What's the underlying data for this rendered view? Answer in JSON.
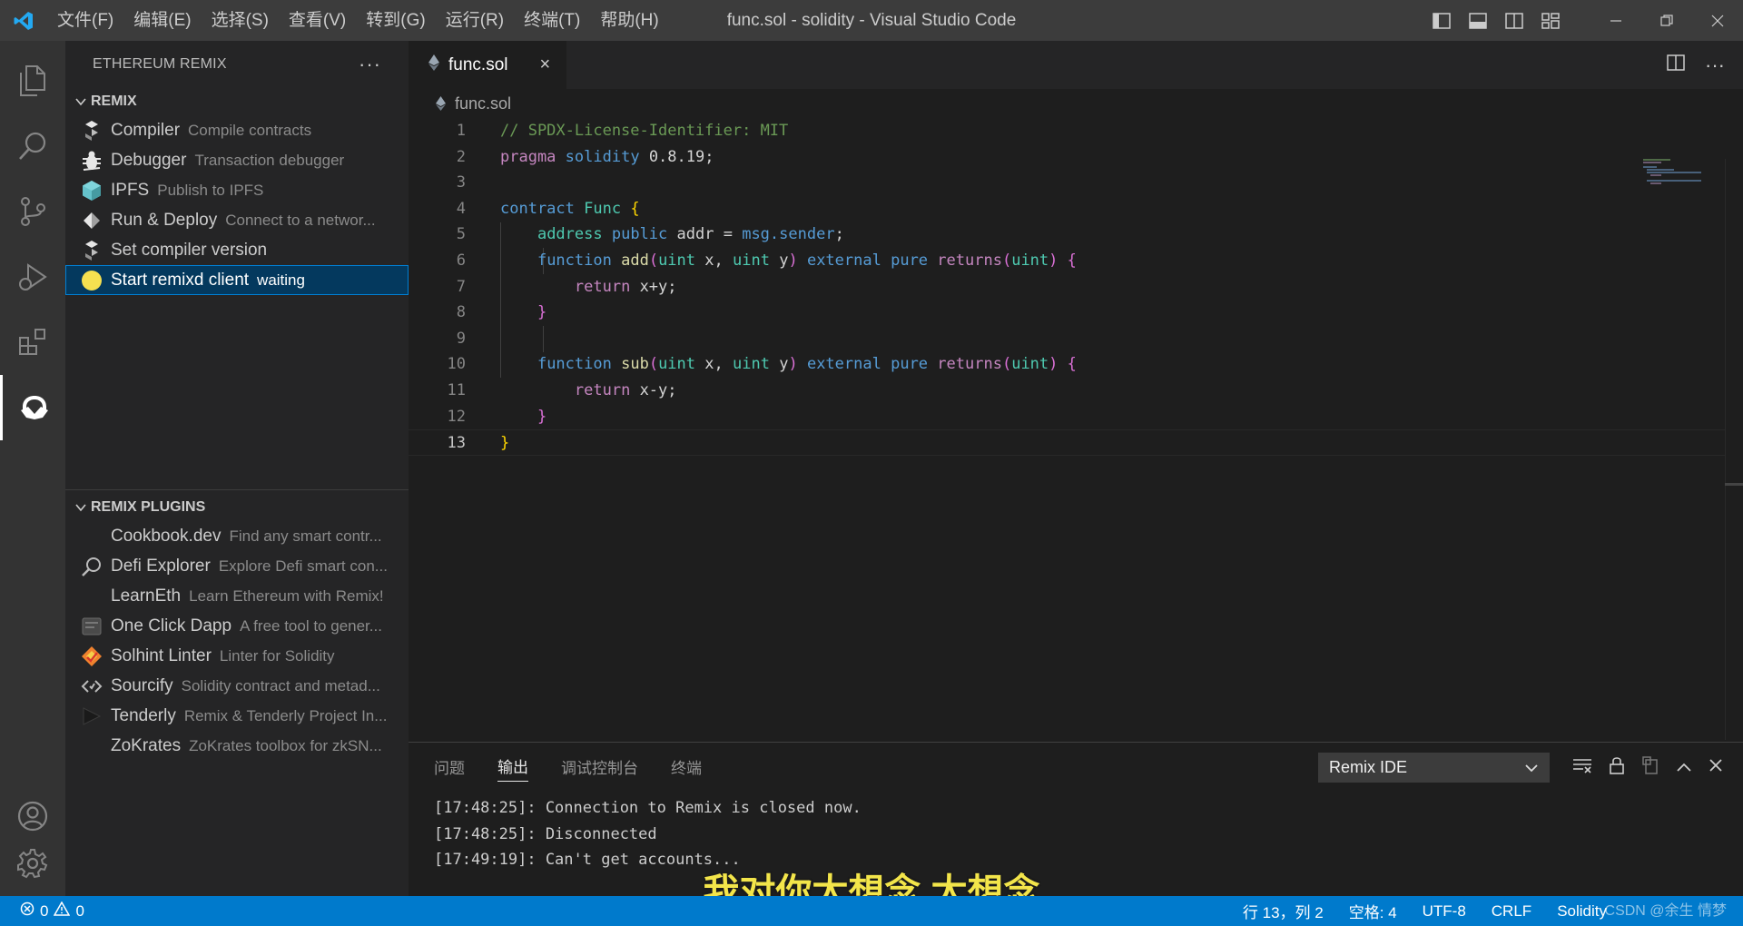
{
  "window": {
    "title": "func.sol - solidity - Visual Studio Code",
    "menu": [
      "文件(F)",
      "编辑(E)",
      "选择(S)",
      "查看(V)",
      "转到(G)",
      "运行(R)",
      "终端(T)",
      "帮助(H)"
    ]
  },
  "activity_bar": [
    "files-icon",
    "search-icon",
    "source-control-icon",
    "run-debug-icon",
    "extensions-icon",
    "remix-icon",
    "account-icon",
    "settings-gear-icon"
  ],
  "sidebar": {
    "title": "ETHEREUM REMIX",
    "more": "···",
    "remix": {
      "heading": "REMIX",
      "items": [
        {
          "label": "Compiler",
          "desc": "Compile contracts",
          "icon": "compiler-icon"
        },
        {
          "label": "Debugger",
          "desc": "Transaction debugger",
          "icon": "bug-icon"
        },
        {
          "label": "IPFS",
          "desc": "Publish to IPFS",
          "icon": "ipfs-cube-icon"
        },
        {
          "label": "Run & Deploy",
          "desc": "Connect to a networ...",
          "icon": "deploy-icon"
        },
        {
          "label": "Set compiler version",
          "desc": "",
          "icon": "compiler-version-icon"
        },
        {
          "label": "Start remixd client",
          "desc": "waiting",
          "icon": "status-dot-icon"
        }
      ]
    },
    "plugins": {
      "heading": "REMIX PLUGINS",
      "items": [
        {
          "label": "Cookbook.dev",
          "desc": "Find any smart contr..."
        },
        {
          "label": "Defi Explorer",
          "desc": "Explore Defi smart con..."
        },
        {
          "label": "LearnEth",
          "desc": "Learn Ethereum with Remix!"
        },
        {
          "label": "One Click Dapp",
          "desc": "A free tool to gener..."
        },
        {
          "label": "Solhint Linter",
          "desc": "Linter for Solidity"
        },
        {
          "label": "Sourcify",
          "desc": "Solidity contract and metad..."
        },
        {
          "label": "Tenderly",
          "desc": "Remix & Tenderly Project In..."
        },
        {
          "label": "ZoKrates",
          "desc": "ZoKrates toolbox for zkSN..."
        }
      ]
    }
  },
  "editor": {
    "tab": "func.sol",
    "tab_close": "×",
    "breadcrumb": "func.sol",
    "line_numbers": [
      "1",
      "2",
      "3",
      "4",
      "5",
      "6",
      "7",
      "8",
      "9",
      "10",
      "11",
      "12",
      "13"
    ],
    "current_line": "13"
  },
  "panel": {
    "tabs": [
      "问题",
      "输出",
      "调试控制台",
      "终端"
    ],
    "active_tab": "输出",
    "channel": "Remix IDE",
    "output": [
      "[17:48:25]: Connection to Remix is closed now.",
      "[17:48:25]: Disconnected",
      "[17:49:19]: Can't get accounts..."
    ]
  },
  "subtitle": "我对你太想念 太想念",
  "statusbar": {
    "errors": "0",
    "warnings": "0",
    "position": "行 13，列 2",
    "spaces": "空格: 4",
    "encoding": "UTF-8",
    "eol": "CRLF",
    "language": "Solidity",
    "watermark": "CSDN @余生 情梦"
  },
  "colors": {
    "accent": "#007acc",
    "selection": "#04395e",
    "status_dot": "#f5e050"
  }
}
